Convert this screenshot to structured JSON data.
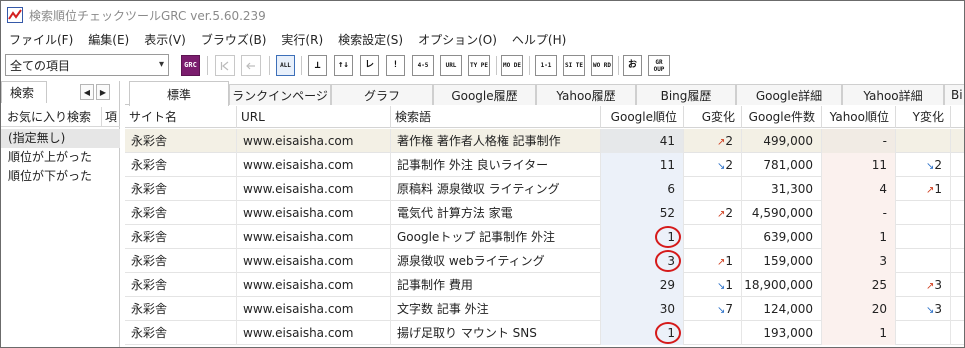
{
  "title": "検索順位チェックツールGRC ver.5.60.239",
  "menu": [
    "ファイル(F)",
    "編集(E)",
    "表示(V)",
    "ブラウズ(B)",
    "実行(R)",
    "検索設定(S)",
    "オプション(O)",
    "ヘルプ(H)"
  ],
  "toolbar": {
    "filter_value": "全ての項目",
    "grc_label": "GRC",
    "buttons": [
      "ALL",
      "⊥",
      "↑↓",
      "レ",
      "!",
      "4-5",
      "URL",
      "TY PE",
      "MO DE",
      "1-1",
      "SI TE",
      "WO RD",
      "お",
      "GR OUP"
    ]
  },
  "left_pane": {
    "tab_label": "検索",
    "header_favorites": "お気に入り検索",
    "header_item": "項",
    "items": [
      "(指定無し)",
      "順位が上がった",
      "順位が下がった"
    ]
  },
  "tabs": [
    "標準",
    "ランクインページ",
    "グラフ",
    "Google履歴",
    "Yahoo履歴",
    "Bing履歴",
    "Google詳細",
    "Yahoo詳細",
    "Bi"
  ],
  "columns": [
    "サイト名",
    "URL",
    "検索語",
    "Google順位",
    "G変化",
    "Google件数",
    "Yahoo順位",
    "Y変化"
  ],
  "rows": [
    {
      "site": "永彩舎",
      "url": "www.eisaisha.com",
      "keyword": "著作権 著作者人格権 記事制作",
      "g_rank": "41",
      "g_change": "2",
      "g_dir": "up",
      "g_count": "499,000",
      "y_rank": "-",
      "y_change": "",
      "y_dir": ""
    },
    {
      "site": "永彩舎",
      "url": "www.eisaisha.com",
      "keyword": "記事制作 外注 良いライター",
      "g_rank": "11",
      "g_change": "2",
      "g_dir": "down",
      "g_count": "781,000",
      "y_rank": "11",
      "y_change": "2",
      "y_dir": "down"
    },
    {
      "site": "永彩舎",
      "url": "www.eisaisha.com",
      "keyword": "原稿料 源泉徴収 ライティング",
      "g_rank": "6",
      "g_change": "",
      "g_dir": "",
      "g_count": "31,300",
      "y_rank": "4",
      "y_change": "1",
      "y_dir": "up"
    },
    {
      "site": "永彩舎",
      "url": "www.eisaisha.com",
      "keyword": "電気代 計算方法 家電",
      "g_rank": "52",
      "g_change": "2",
      "g_dir": "up",
      "g_count": "4,590,000",
      "y_rank": "-",
      "y_change": "",
      "y_dir": ""
    },
    {
      "site": "永彩舎",
      "url": "www.eisaisha.com",
      "keyword": "Googleトップ 記事制作 外注",
      "g_rank": "1",
      "g_change": "",
      "g_dir": "",
      "g_count": "639,000",
      "y_rank": "1",
      "y_change": "",
      "y_dir": ""
    },
    {
      "site": "永彩舎",
      "url": "www.eisaisha.com",
      "keyword": "源泉徴収 webライティング",
      "g_rank": "3",
      "g_change": "1",
      "g_dir": "up",
      "g_count": "159,000",
      "y_rank": "3",
      "y_change": "",
      "y_dir": ""
    },
    {
      "site": "永彩舎",
      "url": "www.eisaisha.com",
      "keyword": "記事制作 費用",
      "g_rank": "29",
      "g_change": "1",
      "g_dir": "down",
      "g_count": "18,900,000",
      "y_rank": "25",
      "y_change": "3",
      "y_dir": "up"
    },
    {
      "site": "永彩舎",
      "url": "www.eisaisha.com",
      "keyword": "文字数 記事 外注",
      "g_rank": "30",
      "g_change": "7",
      "g_dir": "down",
      "g_count": "124,000",
      "y_rank": "20",
      "y_change": "3",
      "y_dir": "down"
    },
    {
      "site": "永彩舎",
      "url": "www.eisaisha.com",
      "keyword": "揚げ足取り マウント SNS",
      "g_rank": "1",
      "g_change": "",
      "g_dir": "",
      "g_count": "193,000",
      "y_rank": "1",
      "y_change": "",
      "y_dir": ""
    }
  ],
  "highlight_rows": [
    4,
    5,
    8
  ],
  "colors": {
    "highlight_circle": "#d51a1a",
    "rank_up": "#d04020",
    "rank_down": "#2a70c8",
    "grc_button": "#7b1d6e"
  }
}
